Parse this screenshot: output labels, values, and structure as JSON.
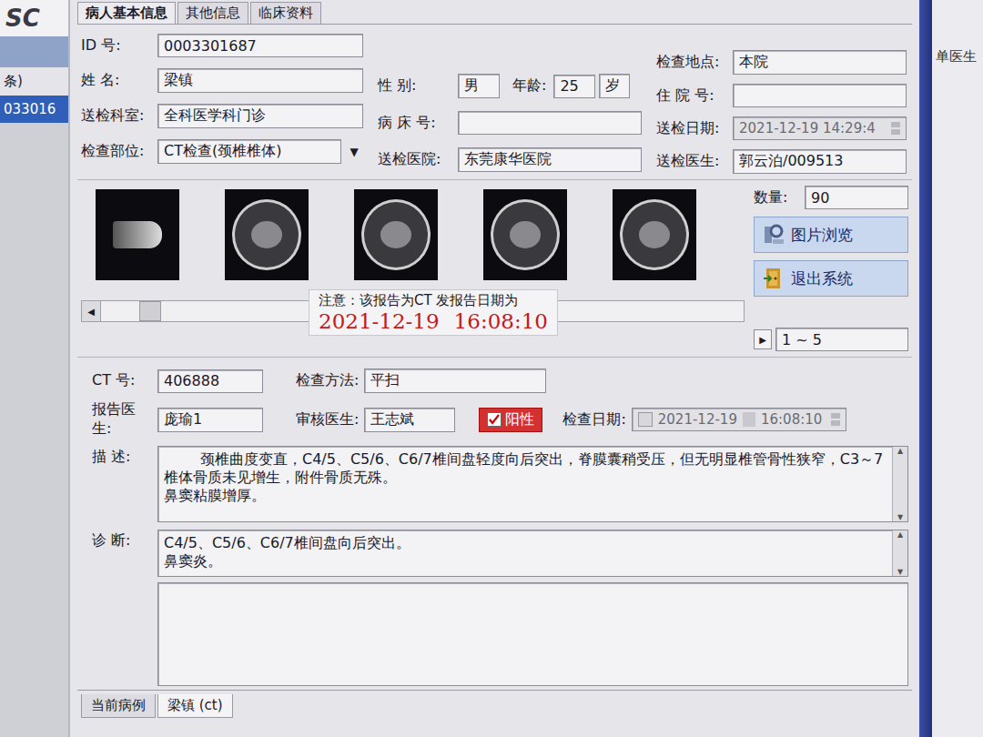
{
  "side": {
    "logo": "SC",
    "items": [
      {
        "label": "条)",
        "selected": false
      },
      {
        "label": "033016",
        "selected": true
      }
    ]
  },
  "edge_text": "单医生",
  "tabs": [
    {
      "label": "病人基本信息",
      "selected": true
    },
    {
      "label": "其他信息",
      "selected": false
    },
    {
      "label": "临床资料",
      "selected": false
    }
  ],
  "patient": {
    "columns": [
      [
        {
          "label": "ID 号:",
          "value": "0003301687",
          "kind": "text"
        },
        {
          "label": "姓 名:",
          "value": "梁镇",
          "kind": "text"
        },
        {
          "label": "送检科室:",
          "value": "全科医学科门诊",
          "kind": "text"
        },
        {
          "label": "检查部位:",
          "value": "CT检查(颈椎椎体)",
          "kind": "dropdown",
          "arrow": "▼"
        }
      ],
      [
        {
          "label": "性 别:",
          "value": "男",
          "kind": "age",
          "age_label": "年龄:",
          "age": "25",
          "unit": "岁"
        },
        {
          "label": "病 床 号:",
          "value": "",
          "kind": "text"
        },
        {
          "label": "送检医院:",
          "value": "东莞康华医院",
          "kind": "text"
        }
      ],
      [
        {
          "label": "检查地点:",
          "value": "本院",
          "kind": "text"
        },
        {
          "label": "住 院 号:",
          "value": "",
          "kind": "text"
        },
        {
          "label": "送检日期:",
          "value": "2021-12-19 14:29:4",
          "kind": "date",
          "disabled": true
        },
        {
          "label": "送检医生:",
          "value": "郭云泊/009513",
          "kind": "text"
        }
      ]
    ]
  },
  "images": {
    "thumbnails": [
      {
        "kind": "scout"
      },
      {
        "kind": "axial"
      },
      {
        "kind": "axial"
      },
      {
        "kind": "axial"
      },
      {
        "kind": "axial"
      }
    ],
    "count_label": "数量:",
    "count": "90",
    "buttons": [
      {
        "label": "图片浏览",
        "kind": "browse"
      },
      {
        "label": "退出系统",
        "kind": "exit"
      }
    ],
    "pager": {
      "arrow": "▶",
      "range": "1 ~ 5"
    },
    "scrollbar": {
      "arrow": "◀",
      "level": 0.06
    }
  },
  "notice": {
    "text": "注意：该报告为CT 发报告日期为",
    "date": "2021-12-19",
    "time": "16:08:10"
  },
  "report": {
    "ct_label": "CT 号:",
    "ct": "406888",
    "method_label": "检查方法:",
    "method": "平扫",
    "reporter_label": "报告医生:",
    "reporter": "庞瑜1",
    "reviewer_label": "审核医生:",
    "reviewer": "王志斌",
    "positive": {
      "label": "阳性",
      "checked": true
    },
    "exam_date_label": "检查日期:",
    "exam_date": {
      "checked": false,
      "disabled": true,
      "date": "2021-12-19",
      "time": "16:08:10"
    },
    "description_label": "描 述:",
    "description": [
      "颈椎曲度变直，C4/5、C5/6、C6/7椎间盘轻度向后突出，脊膜囊稍受压，但无明显椎管骨性狭窄，C3～7椎体骨质未见增生，附件骨质无殊。",
      "鼻窦粘膜增厚。"
    ],
    "diagnosis_label": "诊 断:",
    "diagnosis": [
      "C4/5、C5/6、C6/7椎间盘向后突出。",
      "鼻窦炎。"
    ]
  },
  "bottom_tabs": [
    {
      "label": "当前病例",
      "selected": false
    },
    {
      "label": "梁镇 (ct)",
      "selected": true
    }
  ]
}
